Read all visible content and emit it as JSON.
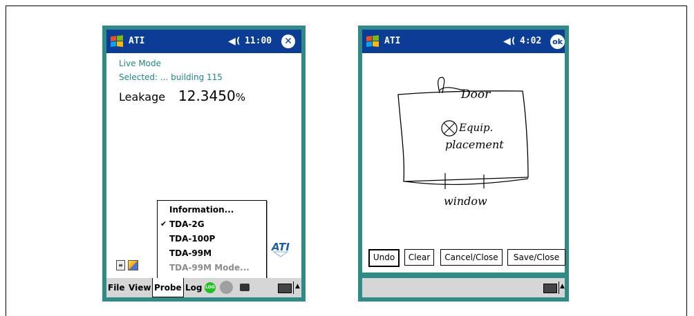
{
  "left": {
    "title": "ATI",
    "time": "11:00",
    "close_glyph": "✕",
    "live_mode": "Live Mode",
    "selected": "Selected: ... building 115",
    "leakage_label": "Leakage",
    "leakage_value": "12.3450",
    "leakage_unit": "%",
    "menu": [
      {
        "label": "Information...",
        "checked": false,
        "enabled": true
      },
      {
        "label": "TDA-2G",
        "checked": true,
        "enabled": true
      },
      {
        "label": "TDA-100P",
        "checked": false,
        "enabled": true
      },
      {
        "label": "TDA-99M",
        "checked": false,
        "enabled": true
      },
      {
        "label": "TDA-99M Mode...",
        "checked": false,
        "enabled": false
      }
    ],
    "menubar": {
      "file": "File",
      "view": "View",
      "probe": "Probe",
      "log": "Log",
      "log_icon": "LOG"
    },
    "logo_text": "ATI"
  },
  "right": {
    "title": "ATI",
    "time": "4:02",
    "ok": "ok",
    "ink": {
      "top": "Door",
      "center1": "Equip.",
      "center2": "placement",
      "bottom": "window"
    },
    "buttons": {
      "undo": "Undo",
      "clear": "Clear",
      "cancel": "Cancel/Close",
      "save": "Save/Close"
    }
  },
  "colors": {
    "titlebar": "#0b3c96",
    "device": "#2e8b86",
    "accent_text": "#1f8a7f",
    "log_green": "#22c022"
  },
  "icons": [
    "windows-logo-icon",
    "speaker-icon",
    "close-icon",
    "ok-icon",
    "log-icon",
    "record-icon",
    "camera-icon",
    "keyboard-icon",
    "sip-arrow-icon",
    "check-icon",
    "ati-logo"
  ]
}
